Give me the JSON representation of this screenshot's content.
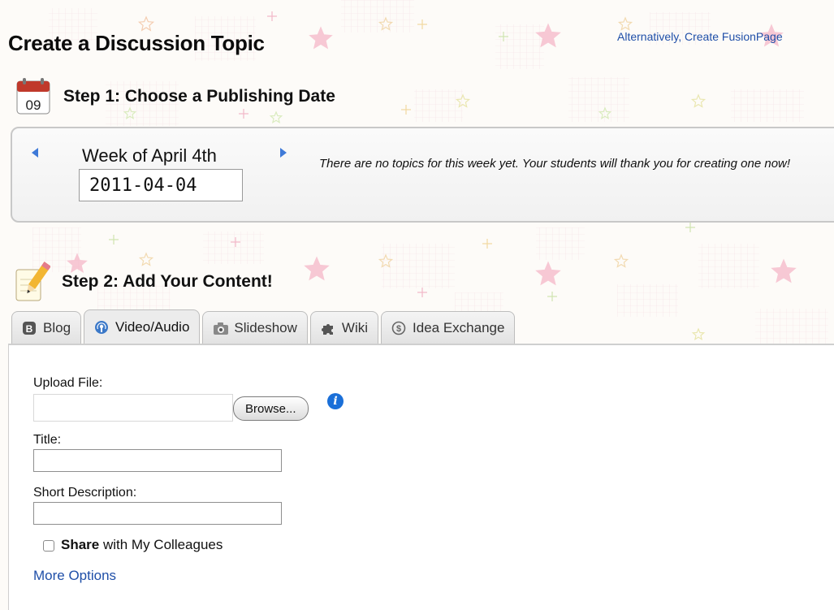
{
  "header": {
    "title": "Create a Discussion Topic",
    "alt_link": "Alternatively, Create FusionPage"
  },
  "step1": {
    "icon_day": "09",
    "heading": "Step 1: Choose a Publishing Date",
    "week_label": "Week of April 4th",
    "date_value": "2011-04-04",
    "message": "There are no topics for this week yet. Your students will thank you for creating one now!"
  },
  "step2": {
    "heading": "Step 2: Add Your Content!",
    "tabs": [
      {
        "label": "Blog",
        "icon": "blog-icon"
      },
      {
        "label": "Video/Audio",
        "icon": "podcast-icon",
        "active": true
      },
      {
        "label": "Slideshow",
        "icon": "camera-icon"
      },
      {
        "label": "Wiki",
        "icon": "puzzle-icon"
      },
      {
        "label": "Idea Exchange",
        "icon": "exchange-icon"
      }
    ]
  },
  "form": {
    "upload_label": "Upload File:",
    "browse_label": "Browse...",
    "title_label": "Title:",
    "title_value": "",
    "desc_label": "Short Description:",
    "desc_value": "",
    "share_bold": "Share",
    "share_rest": " with My Colleagues",
    "share_checked": false,
    "more_options": "More Options"
  },
  "colors": {
    "link": "#1f4fa8",
    "arrow": "#3f7ad8",
    "info": "#1a6fd8",
    "calendar_red": "#c0392b"
  }
}
